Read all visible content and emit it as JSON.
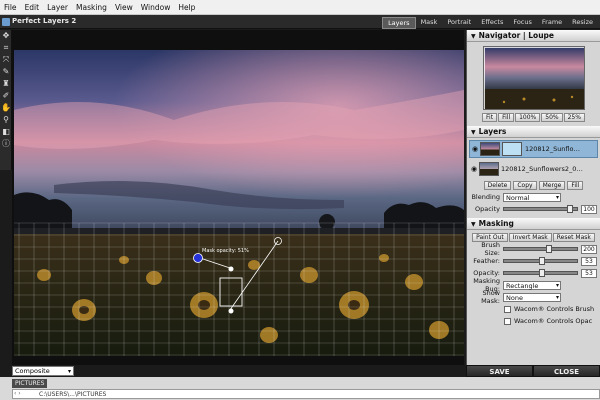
{
  "menu": [
    "File",
    "Edit",
    "Layer",
    "Masking",
    "View",
    "Window",
    "Help"
  ],
  "app": {
    "title": "Perfect Layers 2"
  },
  "mode_tabs": [
    {
      "label": "Layers",
      "active": true
    },
    {
      "label": "Mask",
      "active": false
    },
    {
      "label": "Portrait",
      "active": false
    },
    {
      "label": "Effects",
      "active": false
    },
    {
      "label": "Focus",
      "active": false
    },
    {
      "label": "Frame",
      "active": false
    },
    {
      "label": "Resize",
      "active": false
    }
  ],
  "tools": [
    "move-icon",
    "crop-icon",
    "transform-icon",
    "brush-icon",
    "masking-brush-icon",
    "retouch-icon",
    "hand-icon",
    "zoom-icon",
    "compare-icon",
    "info-icon"
  ],
  "canvas": {
    "mask_opacity_label": "Mask opacity: 51%",
    "view_select": "Composite"
  },
  "navigator": {
    "title_a": "Navigator",
    "title_sep": " | ",
    "title_b": "Loupe",
    "buttons": [
      "Fit",
      "Fill",
      "100%",
      "50%",
      "25%"
    ]
  },
  "layers": {
    "title": "Layers",
    "items": [
      {
        "name": "120812_Sunflo…",
        "selected": true
      },
      {
        "name": "120812_Sunflowers2_0…",
        "selected": false
      }
    ],
    "buttons": [
      "Delete",
      "Copy",
      "Merge",
      "Fill"
    ],
    "blending_label": "Blending",
    "blending_value": "Normal",
    "opacity_label": "Opacity",
    "opacity_value": "100"
  },
  "masking": {
    "title": "Masking",
    "buttons": [
      "Paint Out",
      "Invert Mask",
      "Reset Mask"
    ],
    "brush_size_label": "Brush Size:",
    "brush_size_value": "200",
    "feather_label": "Feather:",
    "feather_value": "53",
    "opacity_label": "Opacity:",
    "opacity_value": "53",
    "masking_bug_label": "Masking Bug:",
    "masking_bug_value": "Rectangle",
    "show_mask_label": "Show Mask:",
    "show_mask_value": "None",
    "wacom_brush": "Wacom® Controls Brush",
    "wacom_opacity": "Wacom® Controls Opac"
  },
  "actions": {
    "save": "SAVE",
    "close": "CLOSE"
  },
  "bottom": {
    "tab": "PICTURES",
    "path": "C:\\USERS\\...\\PICTURES",
    "nav": "‹ ›"
  },
  "colors": {
    "accent": "#5b86aa",
    "selected_layer": "#8fb6d6",
    "panel": "#d5d5d5",
    "sky_top": "#2e3a66",
    "sky_pink": "#e99ab0"
  }
}
